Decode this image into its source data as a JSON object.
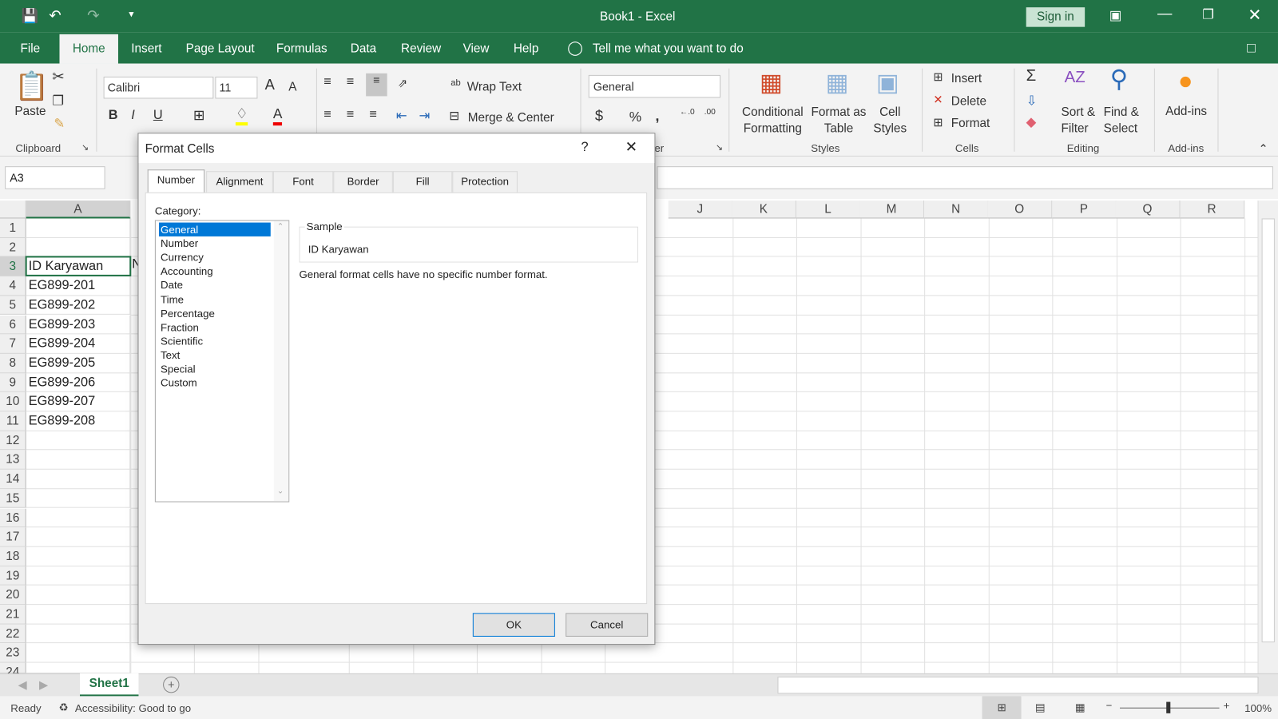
{
  "window": {
    "title": "Book1  -  Excel",
    "sign_in": "Sign in"
  },
  "menu": [
    "File",
    "Home",
    "Insert",
    "Page Layout",
    "Formulas",
    "Data",
    "Review",
    "View",
    "Help"
  ],
  "tell_me": "Tell me what you want to do",
  "ribbon": {
    "paste": "Paste",
    "clipboard": "Clipboard",
    "font_name": "Calibri",
    "font_size": "11",
    "bold": "B",
    "italic": "I",
    "underline": "U",
    "wrap_text": "Wrap Text",
    "merge_center": "Merge & Center",
    "number_format": "General",
    "number_group_tail": "er",
    "conditional": [
      "Conditional",
      "Formatting"
    ],
    "format_table": [
      "Format as",
      "Table"
    ],
    "cell_styles": [
      "Cell",
      "Styles"
    ],
    "styles": "Styles",
    "insert": "Insert",
    "delete": "Delete",
    "format": "Format",
    "cells": "Cells",
    "sort": [
      "Sort &",
      "Filter"
    ],
    "find": [
      "Find &",
      "Select"
    ],
    "editing": "Editing",
    "addins": "Add-ins",
    "addins_group": "Add-ins"
  },
  "name_box": "A3",
  "columns": [
    "A",
    "J",
    "K",
    "L",
    "M",
    "N",
    "O",
    "P",
    "Q",
    "R"
  ],
  "rows": [
    "1",
    "2",
    "3",
    "4",
    "5",
    "6",
    "7",
    "8",
    "9",
    "10",
    "11",
    "12",
    "13",
    "14",
    "15",
    "16",
    "17",
    "18",
    "19",
    "20",
    "21",
    "22",
    "23",
    "24"
  ],
  "cells_A": [
    "",
    "",
    "ID Karyawan",
    "EG899-201",
    "EG899-202",
    "EG899-203",
    "EG899-204",
    "EG899-205",
    "EG899-206",
    "EG899-207",
    "EG899-208"
  ],
  "b3_partial": "N",
  "sheet_tab": "Sheet1",
  "status": {
    "ready": "Ready",
    "accessibility": "Accessibility: Good to go",
    "zoom": "100%"
  },
  "dialog": {
    "title": "Format Cells",
    "help": "?",
    "tabs": [
      "Number",
      "Alignment",
      "Font",
      "Border",
      "Fill",
      "Protection"
    ],
    "active_tab": "Number",
    "category_label": "Category:",
    "categories": [
      "General",
      "Number",
      "Currency",
      "Accounting",
      "Date",
      "Time",
      "Percentage",
      "Fraction",
      "Scientific",
      "Text",
      "Special",
      "Custom"
    ],
    "selected_category": "General",
    "sample_label": "Sample",
    "sample_value": "ID Karyawan",
    "description": "General format cells have no specific number format.",
    "ok": "OK",
    "cancel": "Cancel"
  },
  "colors": {
    "brand": "#217346",
    "selection": "#0078d7"
  }
}
